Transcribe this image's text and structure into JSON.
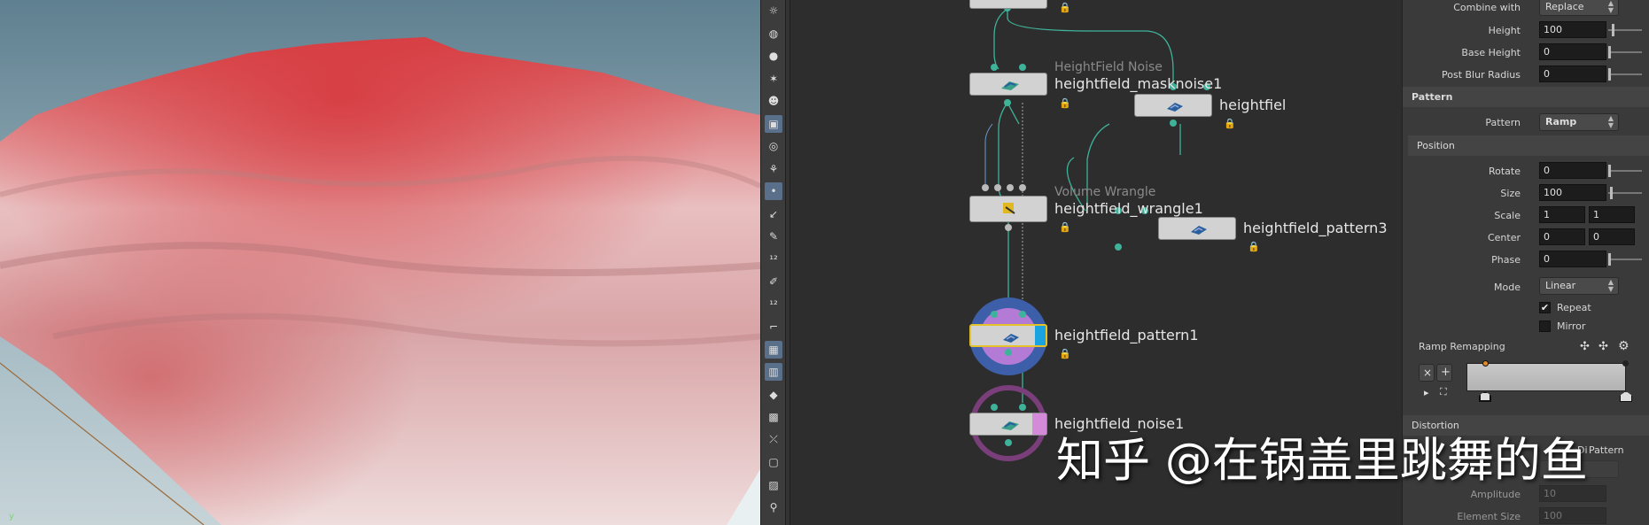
{
  "viewport": {
    "axis_label": "y"
  },
  "viewport_tools": [
    "light-icon",
    "sphere-icon",
    "bulb-icon",
    "spot-light-icon",
    "skull-light-icon",
    "camera-icon",
    "eye-icon",
    "rig-icon",
    "dot-icon",
    "line-icon",
    "paint-icon",
    "count-12-icon",
    "brush-icon",
    "count-12b-icon",
    "corner-icon",
    "wedge-icon",
    "grid-icon",
    "diamond-icon",
    "box-icon",
    "split-icon",
    "square-icon",
    "image-icon",
    "pin-icon"
  ],
  "network": {
    "nodes": {
      "masknoise": {
        "type": "HeightField Noise",
        "name": "heightfield_masknoise1"
      },
      "pattern_right": {
        "name": "heightfiel"
      },
      "wrangle": {
        "type": "Volume Wrangle",
        "name": "heightfield_wrangle1"
      },
      "pattern3": {
        "name": "heightfield_pattern3"
      },
      "pattern1": {
        "name": "heightfield_pattern1"
      },
      "noise1": {
        "name": "heightfield_noise1"
      }
    },
    "lock_glyph": "🔒"
  },
  "params": {
    "combine_with": {
      "label": "Combine with",
      "value": "Replace"
    },
    "height": {
      "label": "Height",
      "value": "100"
    },
    "base_height": {
      "label": "Base Height",
      "value": "0"
    },
    "post_blur": {
      "label": "Post Blur Radius",
      "value": "0"
    },
    "pattern_section": "Pattern",
    "pattern": {
      "label": "Pattern",
      "value": "Ramp"
    },
    "position_section": "Position",
    "rotate": {
      "label": "Rotate",
      "value": "0"
    },
    "size": {
      "label": "Size",
      "value": "100"
    },
    "scale": {
      "label": "Scale",
      "x": "1",
      "y": "1"
    },
    "center": {
      "label": "Center",
      "x": "0",
      "y": "0"
    },
    "phase": {
      "label": "Phase",
      "value": "0"
    },
    "mode": {
      "label": "Mode",
      "value": "Linear"
    },
    "repeat": {
      "label": "Repeat",
      "checked": true,
      "glyph": "✔"
    },
    "mirror": {
      "label": "Mirror",
      "checked": false
    },
    "ramp_remapping": "Ramp Remapping",
    "ramp_buttons": {
      "remove": "×",
      "add": "+",
      "play": "▸",
      "fit": "⛶"
    },
    "distortion_section": "Distortion",
    "distortion_toggle": "Di",
    "distortion_pattern": "Pattern",
    "amplitude": {
      "label": "Amplitude",
      "value": "10"
    },
    "element_size": {
      "label": "Element Size",
      "value": "100"
    }
  },
  "watermark": "知乎 @在锅盖里跳舞的鱼",
  "colors": {
    "wire": "#3fb39a",
    "selected": "#e6c229",
    "node_body": "#d2d2d2"
  }
}
